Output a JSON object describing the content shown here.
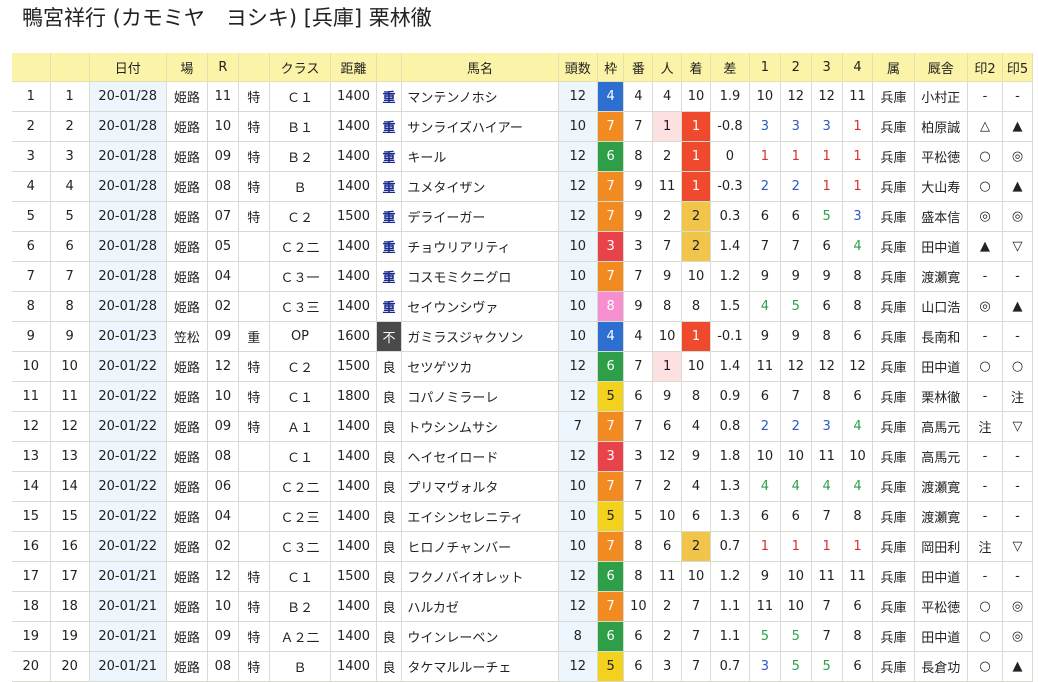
{
  "page": {
    "title": "鴨宮祥行 (カモミヤ　ヨシキ) [兵庫] 栗林徹"
  },
  "headers": [
    "",
    "",
    "日付",
    "場",
    "R",
    "",
    "クラス",
    "距離",
    "",
    "馬名",
    "頭数",
    "枠",
    "番",
    "人",
    "着",
    "差",
    "1",
    "2",
    "3",
    "4",
    "属",
    "厩舎",
    "印2",
    "印5"
  ],
  "rows": [
    [
      "1",
      "1",
      "20-01/28",
      "姫路",
      "11",
      "特",
      "Ｃ１",
      "1400",
      "重",
      "マンテンノホシ",
      "12",
      "4",
      "4",
      "4",
      "10",
      "1.9",
      "10",
      "12",
      "12",
      "11",
      "兵庫",
      "小村正",
      "-",
      "-"
    ],
    [
      "2",
      "2",
      "20-01/28",
      "姫路",
      "10",
      "特",
      "Ｂ１",
      "1400",
      "重",
      "サンライズハイアー",
      "10",
      "7",
      "7",
      "1",
      "1",
      "-0.8",
      "3",
      "3",
      "3",
      "1",
      "兵庫",
      "柏原誠",
      "△",
      "▲"
    ],
    [
      "3",
      "3",
      "20-01/28",
      "姫路",
      "09",
      "特",
      "Ｂ２",
      "1400",
      "重",
      "キール",
      "12",
      "6",
      "8",
      "2",
      "1",
      "0",
      "1",
      "1",
      "1",
      "1",
      "兵庫",
      "平松徳",
      "○",
      "◎"
    ],
    [
      "4",
      "4",
      "20-01/28",
      "姫路",
      "08",
      "特",
      "Ｂ",
      "1400",
      "重",
      "ユメタイザン",
      "12",
      "7",
      "9",
      "11",
      "1",
      "-0.3",
      "2",
      "2",
      "1",
      "1",
      "兵庫",
      "大山寿",
      "○",
      "▲"
    ],
    [
      "5",
      "5",
      "20-01/28",
      "姫路",
      "07",
      "特",
      "Ｃ２",
      "1500",
      "重",
      "デライーガー",
      "12",
      "7",
      "9",
      "2",
      "2",
      "0.3",
      "6",
      "6",
      "5",
      "3",
      "兵庫",
      "盛本信",
      "◎",
      "◎"
    ],
    [
      "6",
      "6",
      "20-01/28",
      "姫路",
      "05",
      "",
      "Ｃ２二",
      "1400",
      "重",
      "チョウリアリティ",
      "10",
      "3",
      "3",
      "7",
      "2",
      "1.4",
      "7",
      "7",
      "6",
      "4",
      "兵庫",
      "田中道",
      "▲",
      "▽"
    ],
    [
      "7",
      "7",
      "20-01/28",
      "姫路",
      "04",
      "",
      "Ｃ３一",
      "1400",
      "重",
      "コスモミクニグロ",
      "10",
      "7",
      "7",
      "9",
      "10",
      "1.2",
      "9",
      "9",
      "9",
      "8",
      "兵庫",
      "渡瀬寛",
      "-",
      "-"
    ],
    [
      "8",
      "8",
      "20-01/28",
      "姫路",
      "02",
      "",
      "Ｃ３三",
      "1400",
      "重",
      "セイウンシヴァ",
      "10",
      "8",
      "9",
      "8",
      "8",
      "1.5",
      "4",
      "5",
      "6",
      "8",
      "兵庫",
      "山口浩",
      "◎",
      "▲"
    ],
    [
      "9",
      "9",
      "20-01/23",
      "笠松",
      "09",
      "重",
      "OP",
      "1600",
      "不",
      "ガミラスジャクソン",
      "10",
      "4",
      "4",
      "10",
      "1",
      "-0.1",
      "9",
      "9",
      "8",
      "6",
      "兵庫",
      "長南和",
      "-",
      "-"
    ],
    [
      "10",
      "10",
      "20-01/22",
      "姫路",
      "12",
      "特",
      "Ｃ２",
      "1500",
      "良",
      "セツゲツカ",
      "12",
      "6",
      "7",
      "1",
      "10",
      "1.4",
      "11",
      "12",
      "12",
      "12",
      "兵庫",
      "田中道",
      "○",
      "○"
    ],
    [
      "11",
      "11",
      "20-01/22",
      "姫路",
      "10",
      "特",
      "Ｃ１",
      "1800",
      "良",
      "コパノミラーレ",
      "12",
      "5",
      "6",
      "9",
      "8",
      "0.9",
      "6",
      "7",
      "8",
      "6",
      "兵庫",
      "栗林徹",
      "-",
      "注"
    ],
    [
      "12",
      "12",
      "20-01/22",
      "姫路",
      "09",
      "特",
      "Ａ１",
      "1400",
      "良",
      "トウシンムサシ",
      "7",
      "7",
      "7",
      "6",
      "4",
      "0.8",
      "2",
      "2",
      "3",
      "4",
      "兵庫",
      "高馬元",
      "注",
      "▽"
    ],
    [
      "13",
      "13",
      "20-01/22",
      "姫路",
      "08",
      "",
      "Ｃ１",
      "1400",
      "良",
      "ヘイセイロード",
      "12",
      "3",
      "3",
      "12",
      "9",
      "1.8",
      "10",
      "10",
      "11",
      "10",
      "兵庫",
      "高馬元",
      "-",
      "-"
    ],
    [
      "14",
      "14",
      "20-01/22",
      "姫路",
      "06",
      "",
      "Ｃ２二",
      "1400",
      "良",
      "プリマヴォルタ",
      "10",
      "7",
      "7",
      "2",
      "4",
      "1.3",
      "4",
      "4",
      "4",
      "4",
      "兵庫",
      "渡瀬寛",
      "-",
      "-"
    ],
    [
      "15",
      "15",
      "20-01/22",
      "姫路",
      "04",
      "",
      "Ｃ２三",
      "1400",
      "良",
      "エイシンセレニティ",
      "10",
      "5",
      "5",
      "10",
      "6",
      "1.3",
      "6",
      "6",
      "7",
      "8",
      "兵庫",
      "渡瀬寛",
      "-",
      "-"
    ],
    [
      "16",
      "16",
      "20-01/22",
      "姫路",
      "02",
      "",
      "Ｃ３二",
      "1400",
      "良",
      "ヒロノチャンバー",
      "10",
      "7",
      "8",
      "6",
      "2",
      "0.7",
      "1",
      "1",
      "1",
      "1",
      "兵庫",
      "岡田利",
      "注",
      "▽"
    ],
    [
      "17",
      "17",
      "20-01/21",
      "姫路",
      "12",
      "特",
      "Ｃ１",
      "1500",
      "良",
      "フクノバイオレット",
      "12",
      "6",
      "8",
      "11",
      "10",
      "1.2",
      "9",
      "10",
      "11",
      "11",
      "兵庫",
      "田中道",
      "-",
      "-"
    ],
    [
      "18",
      "18",
      "20-01/21",
      "姫路",
      "10",
      "特",
      "Ｂ２",
      "1400",
      "良",
      "ハルカゼ",
      "12",
      "7",
      "10",
      "2",
      "7",
      "1.1",
      "11",
      "10",
      "7",
      "6",
      "兵庫",
      "平松徳",
      "○",
      "◎"
    ],
    [
      "19",
      "19",
      "20-01/21",
      "姫路",
      "09",
      "特",
      "Ａ２二",
      "1400",
      "良",
      "ウインレーベン",
      "8",
      "6",
      "6",
      "2",
      "7",
      "1.1",
      "5",
      "5",
      "7",
      "8",
      "兵庫",
      "田中道",
      "○",
      "◎"
    ],
    [
      "20",
      "20",
      "20-01/21",
      "姫路",
      "08",
      "特",
      "Ｂ",
      "1400",
      "良",
      "タケマルルーチェ",
      "12",
      "5",
      "6",
      "3",
      "7",
      "0.7",
      "3",
      "5",
      "5",
      "6",
      "兵庫",
      "長倉功",
      "○",
      "▲"
    ]
  ],
  "colors": {
    "header_bg": "#fbf4a8",
    "date_bg": "#eef6fd",
    "waku": {
      "1": "#ffffff",
      "2": "#222222",
      "3": "#e8434a",
      "4": "#2c6fd1",
      "5": "#f2d21c",
      "6": "#2e9e48",
      "7": "#f28a22",
      "8": "#f58fd0"
    },
    "finish_1st": "#f04a2e",
    "finish_2nd": "#f0c54a",
    "popular_1st": "#fde0e0",
    "corner_1": "#d83030",
    "corner_2": "#2d58c8",
    "corner_3": "#2e9e48"
  }
}
